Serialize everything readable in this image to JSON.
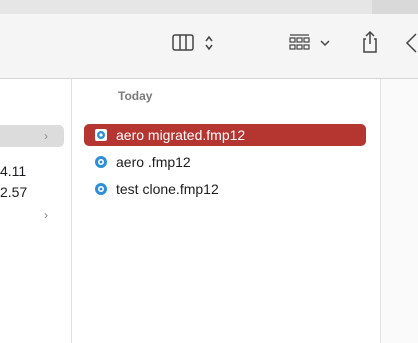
{
  "window": {
    "toolbar": {
      "view_toggle_icon": "column-view-icon",
      "updown_icon": "up-down-chevron-icon",
      "group_icon": "grid-group-icon",
      "group_chevron": "chevron-down-icon",
      "share_icon": "share-icon",
      "back_icon": "chevron-left-icon"
    }
  },
  "left_column": {
    "rows": [
      {
        "text": "",
        "has_chevron": true,
        "selected": true
      },
      {
        "text": "4.11",
        "has_chevron": false
      },
      {
        "text": "2.57",
        "has_chevron": false
      },
      {
        "text": "",
        "has_chevron": true
      }
    ]
  },
  "file_column": {
    "section_header": "Today",
    "files": [
      {
        "name": "aero  migrated.fmp12",
        "selected": true
      },
      {
        "name": "aero .fmp12",
        "selected": false
      },
      {
        "name": "test clone.fmp12",
        "selected": false
      }
    ]
  },
  "colors": {
    "selection": "#b53531",
    "toolbar": "#f5f5f5",
    "icon_blue": "#2f8fd6"
  }
}
